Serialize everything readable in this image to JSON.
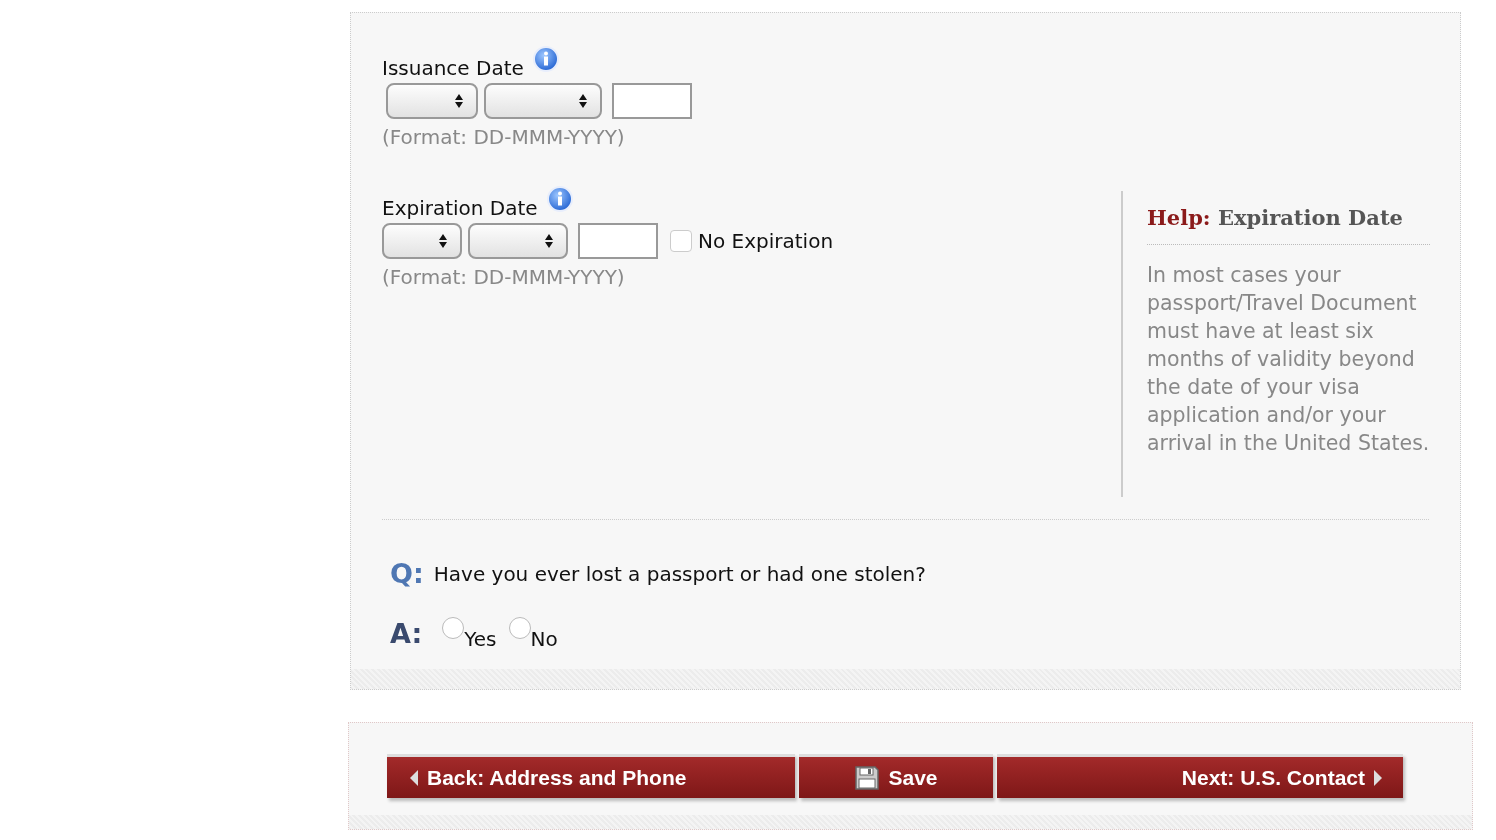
{
  "fields": [
    {
      "label": "Issuance Date",
      "format": "(Format: DD-MMM-YYYY)"
    },
    {
      "label": "Expiration Date",
      "format": "(Format: DD-MMM-YYYY)",
      "no_expiration": {
        "label": "No Expiration",
        "checked": false
      }
    }
  ],
  "help": {
    "prefix": "Help:",
    "heading": "Expiration Date",
    "text": "In most cases your passport/Travel Document must have at least six months of validity beyond the date of your visa application and/or your arrival in the United States."
  },
  "question": {
    "q_label": "Q:",
    "text": "Have you ever lost a passport or had one stolen?",
    "a_label": "A:",
    "options": [
      {
        "label": "Yes",
        "selected": false
      },
      {
        "label": "No",
        "selected": false
      }
    ]
  },
  "buttons": [
    {
      "kind": "back",
      "label": "Back: Address and Phone"
    },
    {
      "kind": "save",
      "label": "Save"
    },
    {
      "kind": "next",
      "label": "Next: U.S. Contact"
    }
  ]
}
